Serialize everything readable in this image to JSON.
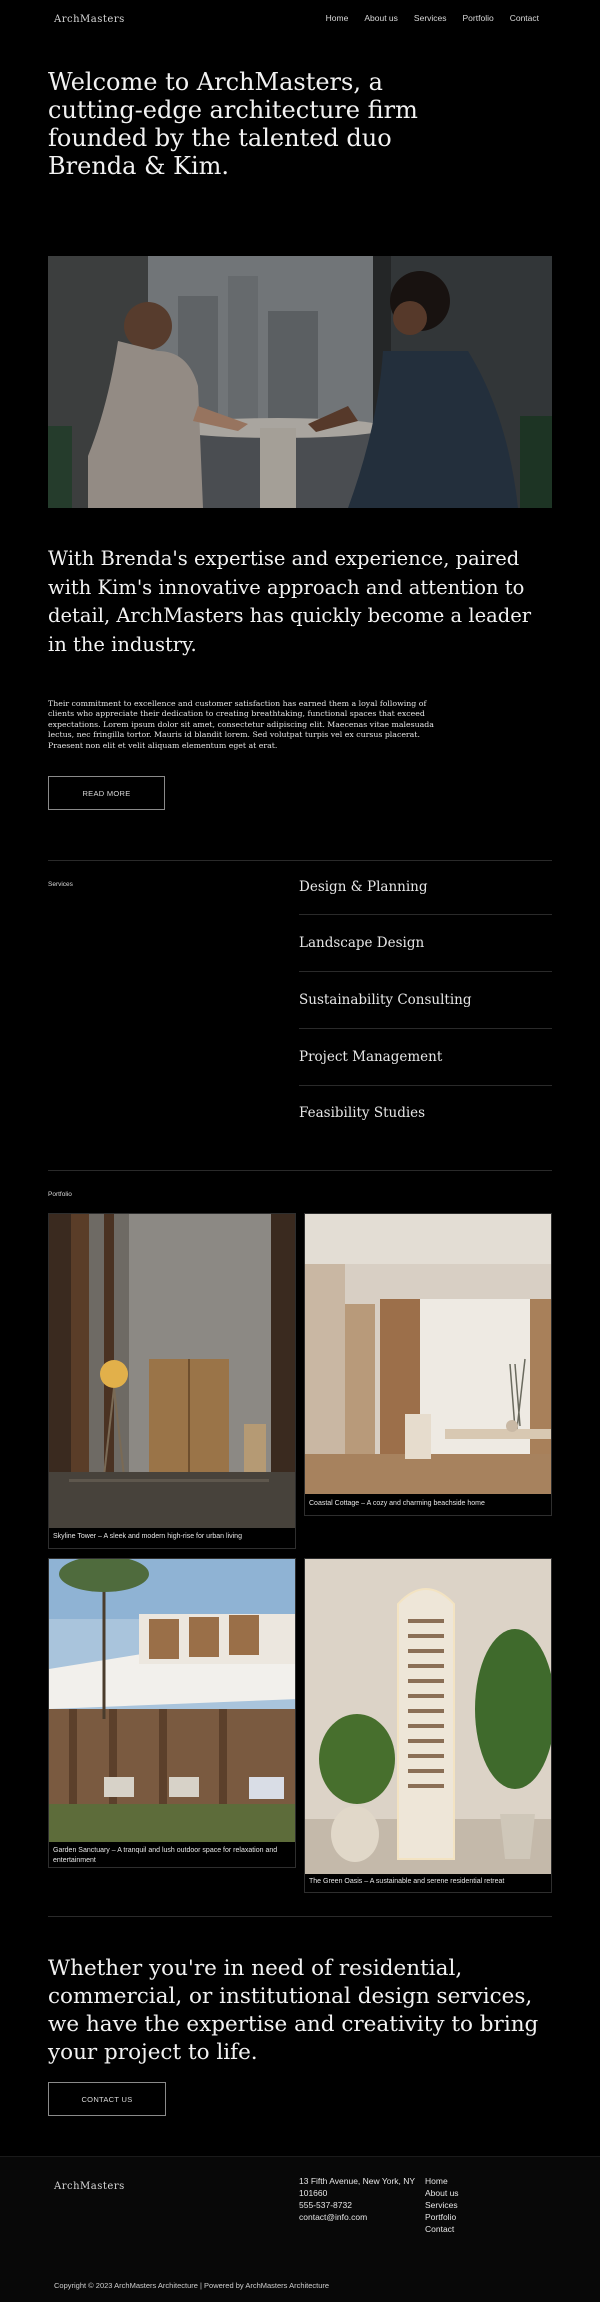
{
  "header": {
    "brand": "ArchMasters",
    "nav": [
      "Home",
      "About us",
      "Services",
      "Portfolio",
      "Contact"
    ]
  },
  "hero": {
    "title": "Welcome to ArchMasters, a cutting-edge architecture firm founded by the talented duo Brenda & Kim."
  },
  "about": {
    "lead": "With Brenda's expertise and experience, paired with Kim's innovative approach and attention to detail, ArchMasters has quickly become a leader in the industry.",
    "body": "Their commitment to excellence and customer satisfaction has earned them a loyal following of clients who appreciate their dedication to creating breathtaking, functional spaces that exceed expectations. Lorem ipsum dolor sit amet, consectetur adipiscing elit. Maecenas vitae malesuada lectus, nec fringilla tortor. Mauris id blandit lorem. Sed volutpat turpis vel ex cursus placerat. Praesent non elit et velit aliquam elementum eget at erat.",
    "button": "READ MORE"
  },
  "services": {
    "label": "Services",
    "items": [
      "Design & Planning",
      "Landscape Design",
      "Sustainability Consulting",
      "Project Management",
      "Feasibility Studies"
    ]
  },
  "portfolio": {
    "label": "Portfolio",
    "items": [
      {
        "caption": "Skyline Tower – A sleek and modern high-rise for urban living"
      },
      {
        "caption": "Coastal Cottage – A cozy and charming beachside home"
      },
      {
        "caption": "Garden Sanctuary – A tranquil and lush outdoor space for relaxation and entertainment"
      },
      {
        "caption": "The Green Oasis – A sustainable and serene residential retreat"
      }
    ]
  },
  "cta": {
    "text": "Whether you're in need of residential, commercial, or institutional design services, we have the expertise and creativity to bring your project to life.",
    "button": "CONTACT US"
  },
  "footer": {
    "brand": "ArchMasters",
    "address": "13 Fifth Avenue, New York, NY",
    "zip": "101660",
    "phone": "555-537-8732",
    "email": "contact@info.com",
    "links": [
      "Home",
      "About us",
      "Services",
      "Portfolio",
      "Contact"
    ],
    "copyright": "Copyright © 2023 ArchMasters Architecture | Powered by ArchMasters Architecture"
  }
}
